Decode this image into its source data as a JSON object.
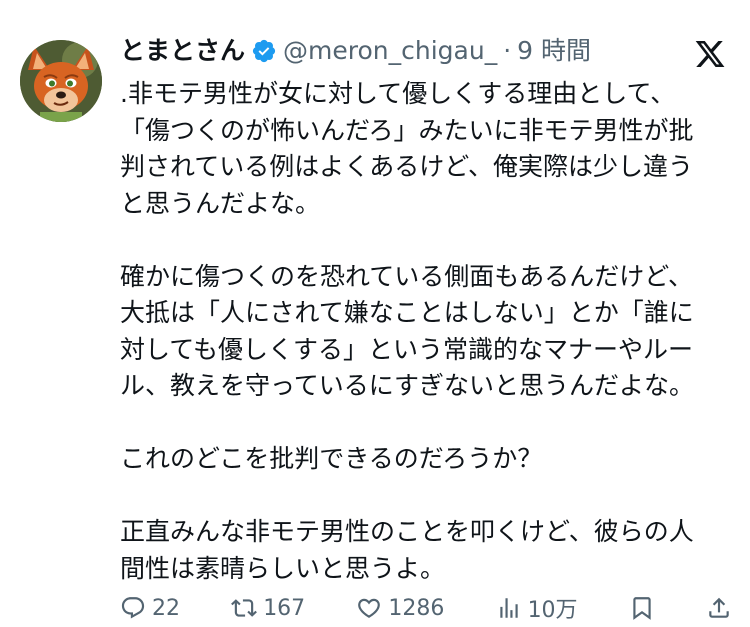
{
  "tweet": {
    "author_name": "とまとさん",
    "handle": "@meron_chigau_",
    "separator": "·",
    "time": "9 時間",
    "body": [
      ".非モテ男性が女に対して優しくする理由として、",
      "「傷つくのが怖いんだろ」みたいに非モテ男性が批",
      "判されている例はよくあるけど、俺実際は少し違う",
      "と思うんだよな。",
      "",
      "確かに傷つくのを恐れている側面もあるんだけど、",
      "大抵は「人にされて嫌なことはしない」とか「誰に",
      "対しても優しくする」という常識的なマナーやルー",
      "ル、教えを守っているにすぎないと思うんだよな。",
      "",
      "これのどこを批判できるのだろうか？",
      "",
      "正直みんな非モテ男性のことを叩くけど、彼らの人",
      "間性は素晴らしいと思うよ。"
    ]
  },
  "actions": {
    "reply_count": "22",
    "retweet_count": "167",
    "like_count": "1286",
    "views_count": "10万"
  },
  "colors": {
    "text": "#0f1419",
    "muted": "#536471",
    "verified": "#1d9bf0"
  },
  "icons": [
    "verified-badge-icon",
    "x-logo-icon",
    "reply-icon",
    "retweet-icon",
    "like-icon",
    "views-icon",
    "bookmark-icon",
    "share-icon"
  ]
}
